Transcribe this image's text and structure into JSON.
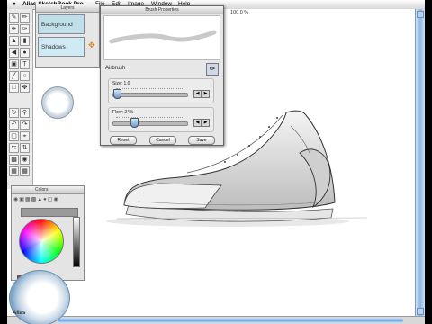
{
  "menubar": {
    "apple": "",
    "app_name": "Alias SketchBook Pro",
    "items": [
      "File",
      "Edit",
      "Image",
      "Window",
      "Help"
    ]
  },
  "zoom_label": "100.0 %",
  "layers_panel": {
    "title": "Layers",
    "layers": [
      "Background",
      "Shadows"
    ]
  },
  "brush_properties": {
    "title": "Brush Properties",
    "brush_name": "Airbrush",
    "size_label": "Size: 1.0",
    "size_value": 1.0,
    "flow_label": "Flow: 24%",
    "flow_value": 24,
    "buttons": [
      "Reset",
      "Cancel",
      "Save"
    ]
  },
  "colors_panel": {
    "title": "Colors",
    "swatches": [
      "#d62020",
      "#2a55d6",
      "#111111",
      "#2a55d6",
      "#ffffff",
      "#ffffff"
    ]
  },
  "logo_text": "Alias",
  "accent_color": "#6aa0de"
}
